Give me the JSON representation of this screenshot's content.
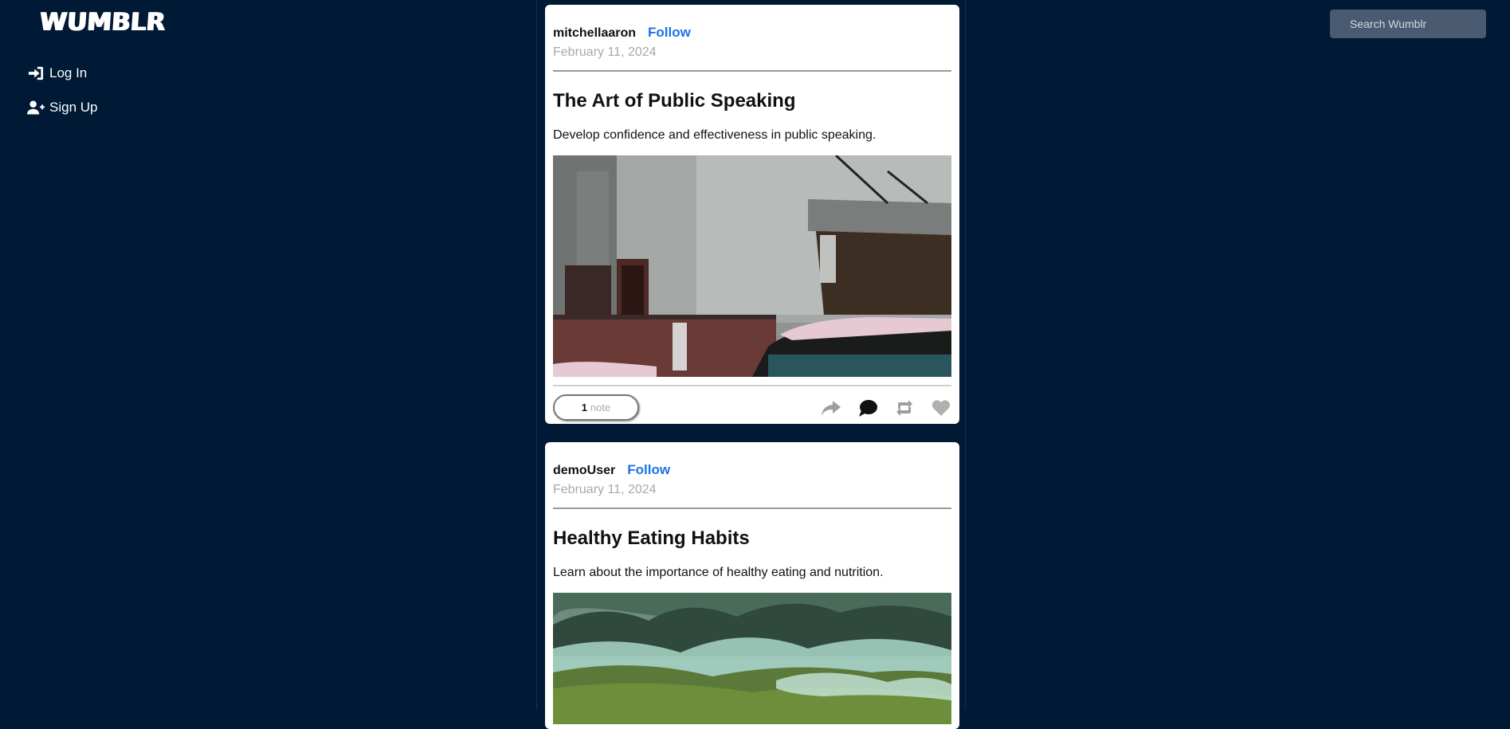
{
  "app": {
    "logo": "WUMBLR"
  },
  "nav": {
    "items": [
      {
        "label": "Log In",
        "icon": "login-icon"
      },
      {
        "label": "Sign Up",
        "icon": "user-plus-icon"
      }
    ]
  },
  "search": {
    "placeholder": "Search Wumblr"
  },
  "posts": [
    {
      "author": "mitchellaaron",
      "follow_label": "Follow",
      "date": "February 11, 2024",
      "title": "The Art of Public Speaking",
      "description": "Develop confidence and effectiveness in public speaking.",
      "notes_count": "1",
      "notes_label": "note",
      "actions": [
        "share-icon",
        "comment-icon",
        "reblog-icon",
        "heart-icon"
      ]
    },
    {
      "author": "demoUser",
      "follow_label": "Follow",
      "date": "February 11, 2024",
      "title": "Healthy Eating Habits",
      "description": "Learn about the importance of healthy eating and nutrition."
    }
  ],
  "colors": {
    "background": "#001935",
    "follow_link": "#1a73e8",
    "search_bg": "#4a5a70"
  }
}
